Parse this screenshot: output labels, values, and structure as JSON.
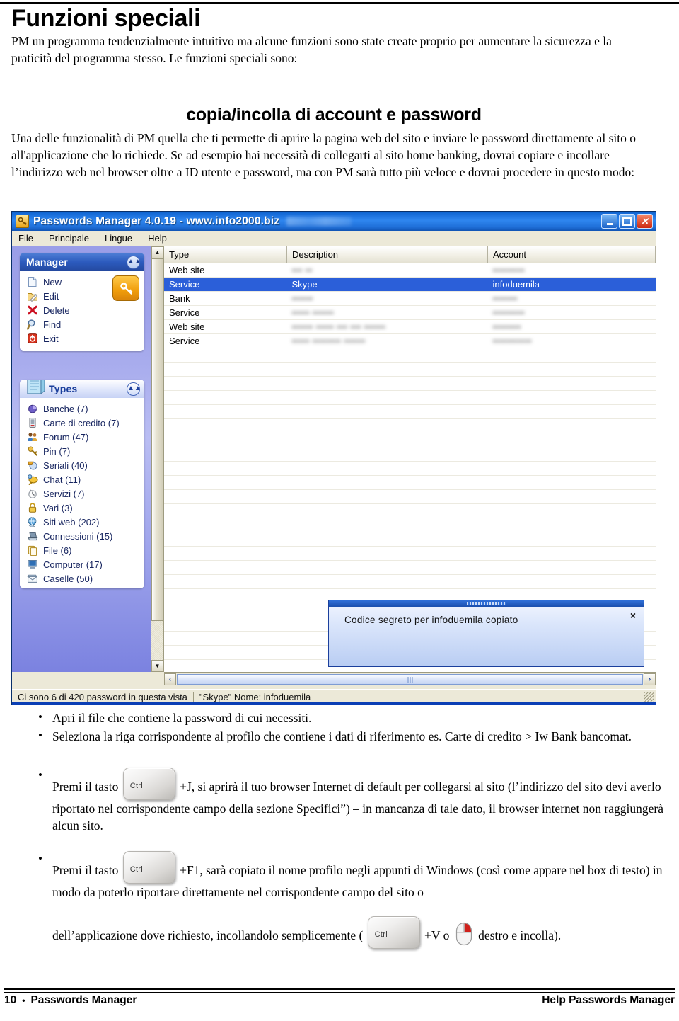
{
  "document": {
    "title": "Funzioni speciali",
    "intro": "PM  un programma tendenzialmente intuitivo ma alcune funzioni sono state create proprio per aumentare la sicurezza e la praticità del programma stesso. Le funzioni speciali sono:",
    "section_heading": "copia/incolla di account e password",
    "body2": "Una delle funzionalità di PM  quella che ti permette di aprire la pagina web del sito e inviare le password direttamente al sito o all'applicazione che lo richiede. Se ad esempio hai necessità di collegarti al sito home banking, dovrai copiare e incollare l’indirizzo web nel browser oltre a ID utente e password, ma con PM sarà tutto più veloce e dovrai procedere in questo modo:"
  },
  "app": {
    "titlebar": {
      "icon": "key-icon",
      "title": "Passwords Manager 4.0.19 - www.info2000.biz",
      "minimize_label": "–",
      "maximize_label": "□",
      "close_label": "×"
    },
    "menu": [
      "File",
      "Principale",
      "Lingue",
      "Help"
    ],
    "taskpane": {
      "manager": {
        "title": "Manager",
        "collapse_icon": "chevron-up-icon",
        "badge_icon": "key-icon",
        "items": [
          {
            "label": "New",
            "icon": "new-document-icon"
          },
          {
            "label": "Edit",
            "icon": "edit-folder-icon"
          },
          {
            "label": "Delete",
            "icon": "delete-x-icon"
          },
          {
            "label": "Find",
            "icon": "magnifier-icon"
          },
          {
            "label": "Exit",
            "icon": "power-exit-icon"
          }
        ]
      },
      "types": {
        "title": "Types",
        "collapse_icon": "chevron-up-icon",
        "header_icon": "notebook-icon",
        "items": [
          {
            "label": "Banche (7)",
            "icon": "bank-icon"
          },
          {
            "label": "Carte di credito (7)",
            "icon": "credit-card-icon"
          },
          {
            "label": "Forum (47)",
            "icon": "forum-people-icon"
          },
          {
            "label": "Pin (7)",
            "icon": "pin-key-icon"
          },
          {
            "label": "Seriali (40)",
            "icon": "serial-icon"
          },
          {
            "label": "Chat (11)",
            "icon": "chat-icon"
          },
          {
            "label": "Servizi (7)",
            "icon": "services-icon"
          },
          {
            "label": "Vari (3)",
            "icon": "lock-icon"
          },
          {
            "label": "Siti web (202)",
            "icon": "globe-icon"
          },
          {
            "label": "Connessioni (15)",
            "icon": "connection-icon"
          },
          {
            "label": "File (6)",
            "icon": "file-icon"
          },
          {
            "label": "Computer (17)",
            "icon": "computer-icon"
          },
          {
            "label": "Caselle (50)",
            "icon": "mailbox-icon"
          }
        ]
      }
    },
    "table": {
      "columns": [
        "Type",
        "Description",
        "Account"
      ],
      "rows": [
        {
          "type": "Web site",
          "description": "••• ••",
          "account": "•••••••••",
          "selected": false,
          "redacted": true
        },
        {
          "type": "Service",
          "description": "Skype",
          "account": "infoduemila",
          "selected": true,
          "redacted": false
        },
        {
          "type": "Bank",
          "description": "••••••",
          "account": "•••••••",
          "selected": false,
          "redacted": true
        },
        {
          "type": "Service",
          "description": "••••• ••••••",
          "account": "•••••••••",
          "selected": false,
          "redacted": true
        },
        {
          "type": "Web site",
          "description": "•••••• ••••• ••• ••• ••••••",
          "account": "••••••••",
          "selected": false,
          "redacted": true
        },
        {
          "type": "Service",
          "description": "••••• •••••••• ••••••",
          "account": "•••••••••••",
          "selected": false,
          "redacted": true
        }
      ],
      "empty_row_count": 22
    },
    "toast": {
      "message": "Codice segreto per infoduemila copiato",
      "close_label": "×"
    },
    "scrollbars": {
      "v_up": "▲",
      "v_down": "▼",
      "h_left": "‹",
      "h_right": "›"
    },
    "statusbar": {
      "left": "Ci sono 6 di 420 password in questa vista",
      "right": "\"Skype\" Nome: infoduemila"
    },
    "colors": {
      "titlebar_blue": "#1f6fd8",
      "selection_blue": "#2b5fd9",
      "taskpane_violet": "#9fa3ea",
      "window_face": "#ece9d8",
      "accent_orange": "#f09d0b"
    }
  },
  "steps": {
    "items": [
      {
        "id": "step-open-file",
        "text": "Apri il file che contiene la password di cui necessiti."
      },
      {
        "id": "step-select-row",
        "text": "Seleziona la riga corrispondente al profilo che contiene i dati di riferimento es. Carte di credito > Iw Bank bancomat."
      }
    ],
    "ctrl_j": {
      "prefix": "Premi il tasto",
      "key_label": "Ctrl",
      "suffix": "+J, si aprirà il tuo browser Internet di default per collegarsi al sito (l’indirizzo del sito devi averlo riportato nel corrispondente campo della sezione Specifici”) – in mancanza di tale dato, il browser internet non raggiungerà alcun sito."
    },
    "ctrl_f1": {
      "prefix": "Premi il tasto",
      "key_label": "Ctrl",
      "suffix": "+F1, sarà copiato il nome profilo negli appunti di Windows (così come appare nel box di testo) in modo da poterlo riportare direttamente nel corrispondente campo del sito o"
    },
    "paste_line": {
      "prefix": "dell’applicazione dove  richiesto, incollandolo semplicemente (",
      "key_label": "Ctrl",
      "middle": "+V o",
      "mouse_icon": "mouse-right-click-icon",
      "suffix": "destro e incolla)."
    }
  },
  "footer": {
    "page_number": "10",
    "separator": "•",
    "left_title": "Passwords Manager",
    "right_title": "Help Passwords Manager"
  }
}
